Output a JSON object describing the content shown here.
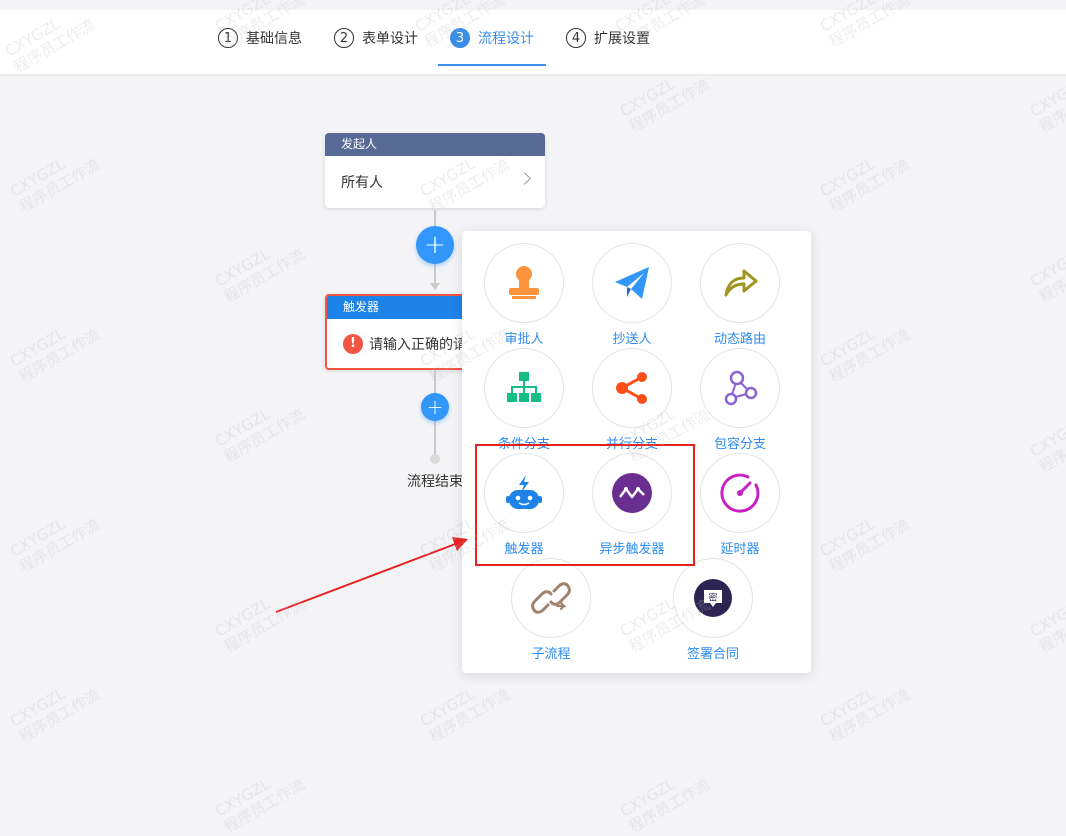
{
  "steps": [
    {
      "num": "1",
      "label": "基础信息",
      "active": false
    },
    {
      "num": "2",
      "label": "表单设计",
      "active": false
    },
    {
      "num": "3",
      "label": "流程设计",
      "active": true
    },
    {
      "num": "4",
      "label": "扩展设置",
      "active": false
    }
  ],
  "starter_node": {
    "title": "发起人",
    "content": "所有人"
  },
  "trigger_node": {
    "title": "触发器",
    "error_icon": "!",
    "content": "请输入正确的请"
  },
  "flow_end": "流程结束",
  "menu": {
    "approver": "审批人",
    "cc": "抄送人",
    "dynamic_route": "动态路由",
    "condition_branch": "条件分支",
    "parallel_branch": "并行分支",
    "inclusive_branch": "包容分支",
    "trigger": "触发器",
    "async_trigger": "异步触发器",
    "delay": "延时器",
    "subprocess": "子流程",
    "sign_contract": "签署合同",
    "sign_contract_badge": "密"
  },
  "watermark": {
    "line1": "CXYGZL",
    "line2": "程序员工作流"
  },
  "colors": {
    "accent": "#3a8ee6",
    "starter": "#576a95",
    "trigger": "#1e83e9",
    "error": "#f25643",
    "highlight": "#e52222"
  }
}
